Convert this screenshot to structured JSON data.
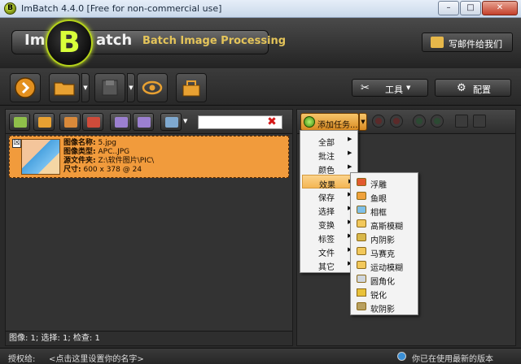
{
  "window": {
    "title": "ImBatch 4.4.0 [Free for non-commercial use]",
    "app_icon_letter": "B",
    "minimize": "–",
    "maximize": "□",
    "close": "✕"
  },
  "banner": {
    "logo_left": "Im",
    "logo_mid": "B",
    "logo_right": "atch",
    "subtitle": "Batch Image Processing",
    "mail_button": "写邮件给我们"
  },
  "toolbar": {
    "tools_label": "工具",
    "config_label": "配置",
    "tools_icon_char": "✂",
    "config_icon_char": "⚙",
    "dropdown_char": "▼"
  },
  "left_toolbar": {
    "search_value": "",
    "clear_char": "✖"
  },
  "image_list": [
    {
      "checkbox_char": "☒",
      "name_label": "图像名称:",
      "name_value": "5.jpg",
      "type_label": "图像类型:",
      "type_value": "APC..JPG",
      "folder_label": "源文件夹:",
      "folder_value": "Z:\\软件图片\\PIC\\",
      "size_label": "尺寸:",
      "size_value": "600 x 378 @ 24"
    }
  ],
  "left_status": "图像: 1; 选择: 1; 检查: 1",
  "right_toolbar": {
    "add_task_label": "添加任务..."
  },
  "task_menu": [
    {
      "label": "全部",
      "has_sub": true
    },
    {
      "label": "批注",
      "has_sub": true
    },
    {
      "label": "颜色",
      "has_sub": true
    },
    {
      "label": "效果",
      "has_sub": true,
      "highlighted": true
    },
    {
      "label": "保存",
      "has_sub": true
    },
    {
      "label": "选择",
      "has_sub": true
    },
    {
      "label": "变换",
      "has_sub": true
    },
    {
      "label": "标签",
      "has_sub": true
    },
    {
      "label": "文件",
      "has_sub": true
    },
    {
      "label": "其它",
      "has_sub": true
    }
  ],
  "effects_menu": [
    "浮雕",
    "鱼眼",
    "相框",
    "高斯模糊",
    "内阴影",
    "马赛克",
    "运动模糊",
    "圆角化",
    "锐化",
    "软阴影"
  ],
  "statusbar": {
    "license_label": "授权给:",
    "license_value": "<点击这里设置你的名字>",
    "version_msg": "你已在使用最新的版本"
  },
  "colors": {
    "selected_item": "#f19b3c",
    "menu_highlight": "#f4b654",
    "accent_green": "#b5d31a"
  }
}
